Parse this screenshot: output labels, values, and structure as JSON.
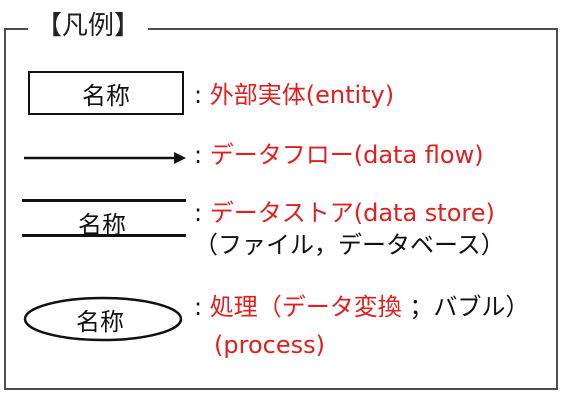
{
  "legend": {
    "title": "【凡例】"
  },
  "symbol_label": "名称",
  "rows": {
    "entity": {
      "colon": ":",
      "text": "外部実体(entity)"
    },
    "flow": {
      "colon": ":",
      "text": "データフロー(data flow)"
    },
    "store": {
      "colon": ":",
      "text": "データストア(data store)",
      "note": "（ファイル，データベース）"
    },
    "process": {
      "colon": ":",
      "text_red1": "処理（データ変換",
      "text_black": "；バブル）",
      "text_red2": "(process)"
    }
  },
  "colors": {
    "accent_red": "#e02020",
    "stroke": "#111111",
    "frame": "#4d4d4d"
  }
}
